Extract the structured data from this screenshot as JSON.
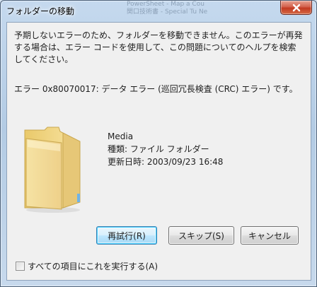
{
  "window": {
    "title": "フォルダーの移動",
    "background_ghost_lines": [
      "PowerSheet - Map a Cou",
      "関口技術書 - Special Tu Ne"
    ]
  },
  "message": {
    "text": "予期しないエラーのため、フォルダーを移動できません。このエラーが再発する場合は、エラー コードを使用して、この問題についてのヘルプを検索してください。",
    "error": "エラー 0x80070017: データ エラー (巡回冗長検査 (CRC) エラー) です。"
  },
  "item": {
    "name": "Media",
    "type_line": "種類: ファイル フォルダー",
    "modified_line": "更新日時: 2003/09/23 16:48",
    "icon": "folder-icon"
  },
  "buttons": {
    "retry": "再試行(R)",
    "skip": "スキップ(S)",
    "cancel": "キャンセル"
  },
  "apply_all": {
    "label": "すべての項目にこれを実行する(A)",
    "checked": false
  },
  "colors": {
    "close_button": "#c23a22",
    "frame": "#b3cbe4",
    "client": "#f0f0f0",
    "folder": "#f0d78c"
  }
}
